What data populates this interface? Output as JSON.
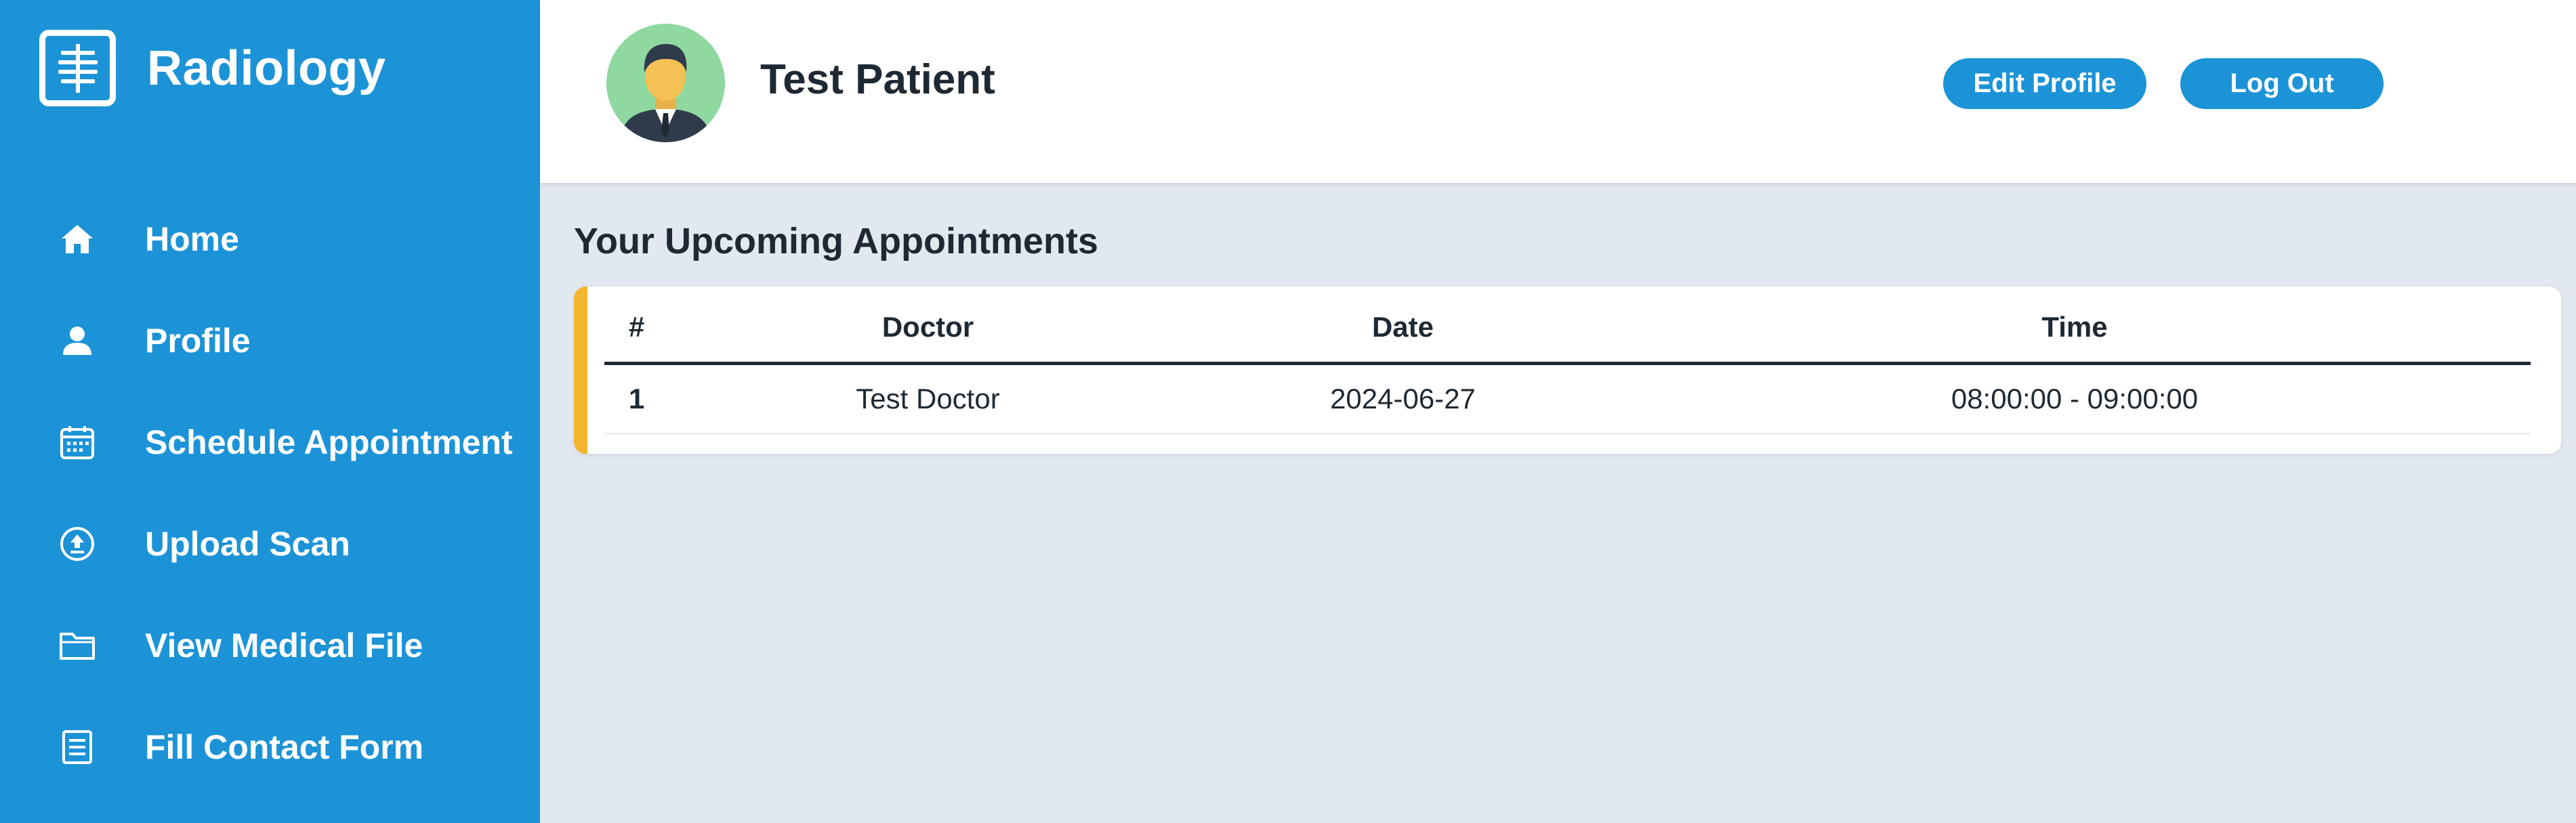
{
  "brand": {
    "name": "Radiology",
    "icon": "xray-icon"
  },
  "sidebar": {
    "items": [
      {
        "label": "Home",
        "icon": "home-icon"
      },
      {
        "label": "Profile",
        "icon": "user-icon"
      },
      {
        "label": "Schedule Appointment",
        "icon": "calendar-icon"
      },
      {
        "label": "Upload Scan",
        "icon": "upload-icon"
      },
      {
        "label": "View Medical File",
        "icon": "folder-icon"
      },
      {
        "label": "Fill Contact Form",
        "icon": "form-icon"
      }
    ]
  },
  "header": {
    "user_name": "Test Patient",
    "edit_profile_label": "Edit Profile",
    "logout_label": "Log Out"
  },
  "appointments": {
    "title": "Your Upcoming Appointments",
    "columns": [
      "#",
      "Doctor",
      "Date",
      "Time"
    ],
    "rows": [
      {
        "index": "1",
        "doctor": "Test Doctor",
        "date": "2024-06-27",
        "time": "08:00:00 - 09:00:00"
      }
    ]
  },
  "colors": {
    "sidebar": "#1c93d7",
    "accent": "#f2b52b",
    "background": "#e2e8f0",
    "avatar_bg": "#8fd8a0"
  }
}
